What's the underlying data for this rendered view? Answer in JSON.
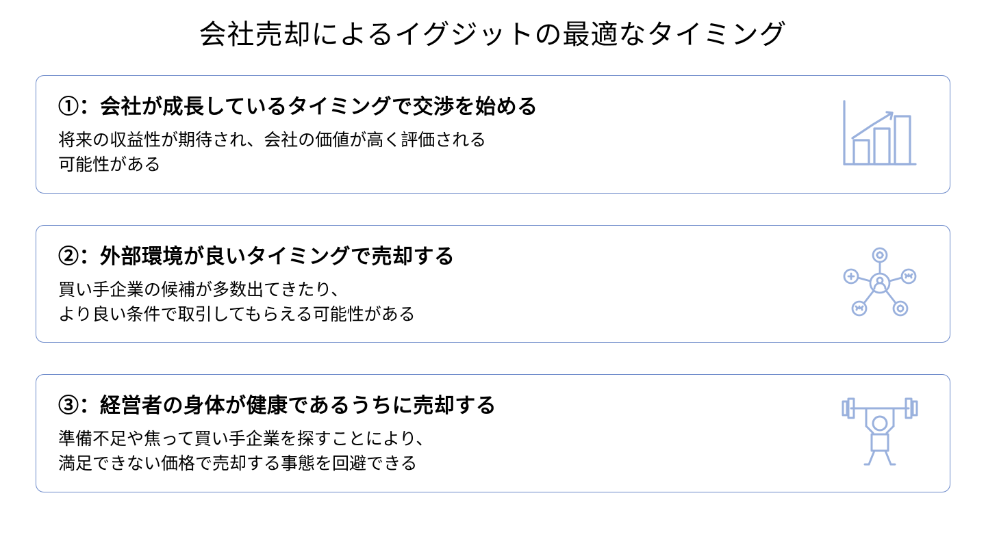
{
  "page": {
    "title": "会社売却によるイグジットの最適なタイミング"
  },
  "cards": [
    {
      "heading": "①：会社が成長しているタイミングで交渉を始める",
      "desc": "将来の収益性が期待され、会社の価値が高く評価される\n可能性がある",
      "icon": "growth-chart-icon"
    },
    {
      "heading": "②：外部環境が良いタイミングで売却する",
      "desc": "買い手企業の候補が多数出てきたり、\nより良い条件で取引してもらえる可能性がある",
      "icon": "network-icon"
    },
    {
      "heading": "③：経営者の身体が健康であるうちに売却する",
      "desc": "準備不足や焦って買い手企業を探すことにより、\n満足できない価格で売却する事態を回避できる",
      "icon": "weightlifting-icon"
    }
  ]
}
